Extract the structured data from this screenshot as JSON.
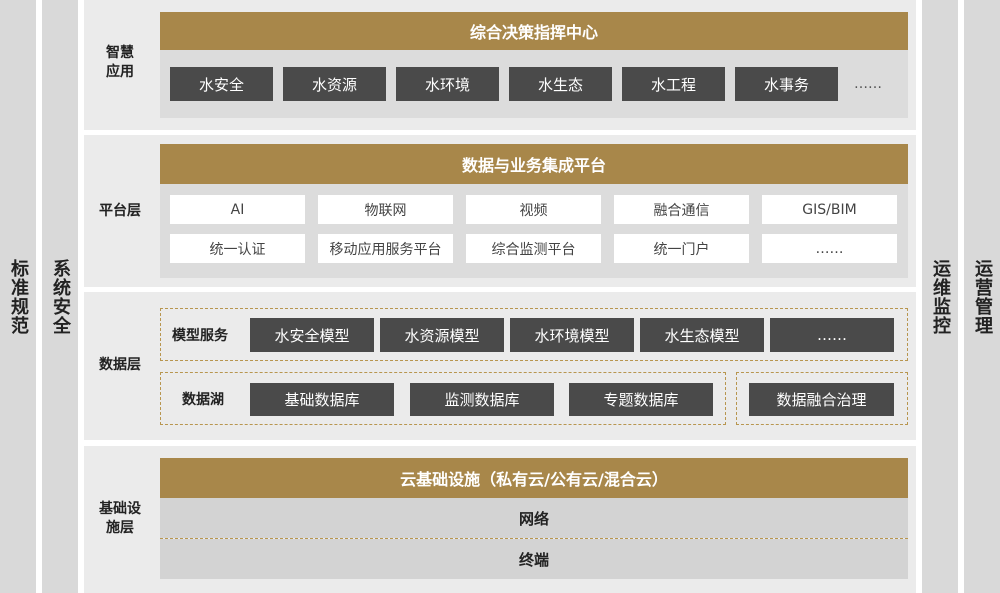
{
  "sidebars": {
    "left_outer": "标准规范",
    "left_inner": "系统安全",
    "right_inner": "运维监控",
    "right_outer": "运营管理"
  },
  "smart_app": {
    "label": "智慧应用",
    "title": "综合决策指挥中心",
    "items": [
      "水安全",
      "水资源",
      "水环境",
      "水生态",
      "水工程",
      "水事务",
      "……"
    ]
  },
  "platform": {
    "label": "平台层",
    "title": "数据与业务集成平台",
    "row1": [
      "AI",
      "物联网",
      "视频",
      "融合通信",
      "GIS/BIM"
    ],
    "row2": [
      "统一认证",
      "移动应用服务平台",
      "综合监测平台",
      "统一门户",
      "……"
    ]
  },
  "data_layer": {
    "label": "数据层",
    "model_label": "模型服务",
    "models": [
      "水安全模型",
      "水资源模型",
      "水环境模型",
      "水生态模型",
      "……"
    ],
    "lake_label": "数据湖",
    "lakes": [
      "基础数据库",
      "监测数据库",
      "专题数据库"
    ],
    "governance": "数据融合治理"
  },
  "infra": {
    "label": "基础设施层",
    "title": "云基础设施（私有云/公有云/混合云）",
    "network": "网络",
    "terminal": "终端"
  },
  "colors": {
    "gold": "#a8874a",
    "dark": "#4a4a4a",
    "panel": "#ebebeb",
    "sidebar": "#d9d9d9"
  }
}
